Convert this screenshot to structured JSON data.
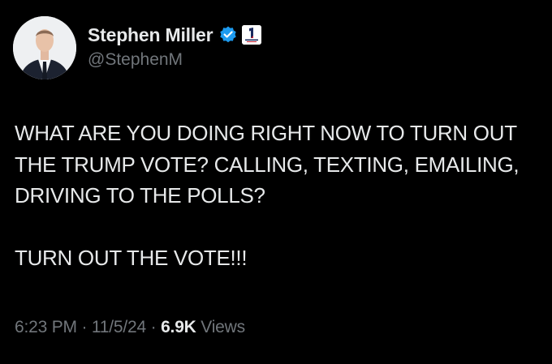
{
  "author": {
    "display_name": "Stephen Miller",
    "handle": "@StephenM",
    "verified_icon": "verified-badge-icon",
    "affiliation_icon": "america-first-legal-icon"
  },
  "tweet": {
    "paragraph_1": "WHAT ARE YOU DOING RIGHT NOW TO TURN OUT THE TRUMP VOTE? CALLING, TEXTING, EMAILING, DRIVING TO THE POLLS?",
    "paragraph_2": "TURN OUT THE VOTE!!!"
  },
  "meta": {
    "time": "6:23 PM",
    "separator": "·",
    "date": "11/5/24",
    "views_count": "6.9K",
    "views_label": "Views"
  },
  "colors": {
    "background": "#000000",
    "text_primary": "#e7e9ea",
    "text_secondary": "#71767b",
    "verified_blue": "#1d9bf0"
  }
}
